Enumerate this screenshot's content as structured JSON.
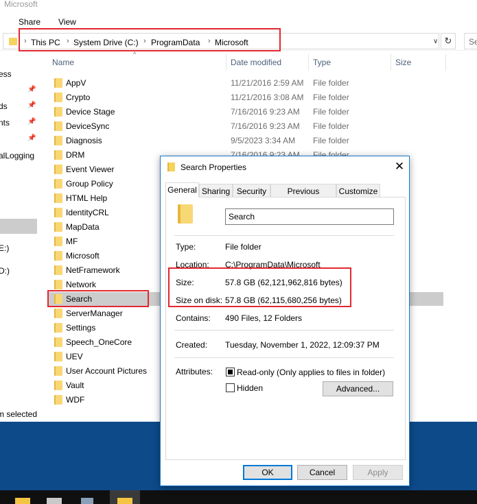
{
  "window": {
    "title": "Microsoft"
  },
  "ribbon": {
    "tabs": [
      "Share",
      "View"
    ]
  },
  "address": {
    "crumbs": [
      "This PC",
      "System Drive (C:)",
      "ProgramData",
      "Microsoft"
    ],
    "search_placeholder": "Se"
  },
  "nav_fragments": [
    "ess",
    "ds",
    "nts",
    "alLogging",
    "E:)",
    "D:)"
  ],
  "columns": {
    "name": "Name",
    "date": "Date modified",
    "type": "Type",
    "size": "Size"
  },
  "files": [
    {
      "name": "AppV",
      "date": "11/21/2016 2:59 AM",
      "type": "File folder"
    },
    {
      "name": "Crypto",
      "date": "11/21/2016 3:08 AM",
      "type": "File folder"
    },
    {
      "name": "Device Stage",
      "date": "7/16/2016 9:23 AM",
      "type": "File folder"
    },
    {
      "name": "DeviceSync",
      "date": "7/16/2016 9:23 AM",
      "type": "File folder"
    },
    {
      "name": "Diagnosis",
      "date": "9/5/2023 3:34 AM",
      "type": "File folder"
    },
    {
      "name": "DRM",
      "date": "7/16/2016 9:23 AM",
      "type": "File folder"
    },
    {
      "name": "Event Viewer",
      "date": "",
      "type": ""
    },
    {
      "name": "Group Policy",
      "date": "",
      "type": ""
    },
    {
      "name": "HTML Help",
      "date": "",
      "type": ""
    },
    {
      "name": "IdentityCRL",
      "date": "",
      "type": ""
    },
    {
      "name": "MapData",
      "date": "",
      "type": ""
    },
    {
      "name": "MF",
      "date": "",
      "type": ""
    },
    {
      "name": "Microsoft",
      "date": "",
      "type": ""
    },
    {
      "name": "NetFramework",
      "date": "",
      "type": ""
    },
    {
      "name": "Network",
      "date": "",
      "type": ""
    },
    {
      "name": "Search",
      "date": "",
      "type": ""
    },
    {
      "name": "ServerManager",
      "date": "",
      "type": ""
    },
    {
      "name": "Settings",
      "date": "",
      "type": ""
    },
    {
      "name": "Speech_OneCore",
      "date": "",
      "type": ""
    },
    {
      "name": "UEV",
      "date": "",
      "type": ""
    },
    {
      "name": "User Account Pictures",
      "date": "",
      "type": ""
    },
    {
      "name": "Vault",
      "date": "",
      "type": ""
    },
    {
      "name": "WDF",
      "date": "",
      "type": ""
    }
  ],
  "status": {
    "text": "m selected"
  },
  "dialog": {
    "title": "Search Properties",
    "close": "✕",
    "tabs": [
      "General",
      "Sharing",
      "Security",
      "Previous Versions",
      "Customize"
    ],
    "folder_name": "Search",
    "type_label": "Type:",
    "type_value": "File folder",
    "location_label": "Location:",
    "location_value": "C:\\ProgramData\\Microsoft",
    "size_label": "Size:",
    "size_value": "57.8 GB (62,121,962,816 bytes)",
    "size_disk_label": "Size on disk:",
    "size_disk_value": "57.8 GB (62,115,680,256 bytes)",
    "contains_label": "Contains:",
    "contains_value": "490 Files, 12 Folders",
    "created_label": "Created:",
    "created_value": "Tuesday, November 1, 2022, 12:09:37 PM",
    "attributes_label": "Attributes:",
    "readonly_label": "Read-only (Only applies to files in folder)",
    "hidden_label": "Hidden",
    "advanced_label": "Advanced...",
    "ok_label": "OK",
    "cancel_label": "Cancel",
    "apply_label": "Apply"
  },
  "colors": {
    "highlight": "#e3262f",
    "selection": "#cccccc",
    "desktop": "#0d4a8a",
    "accent": "#0078d7"
  }
}
